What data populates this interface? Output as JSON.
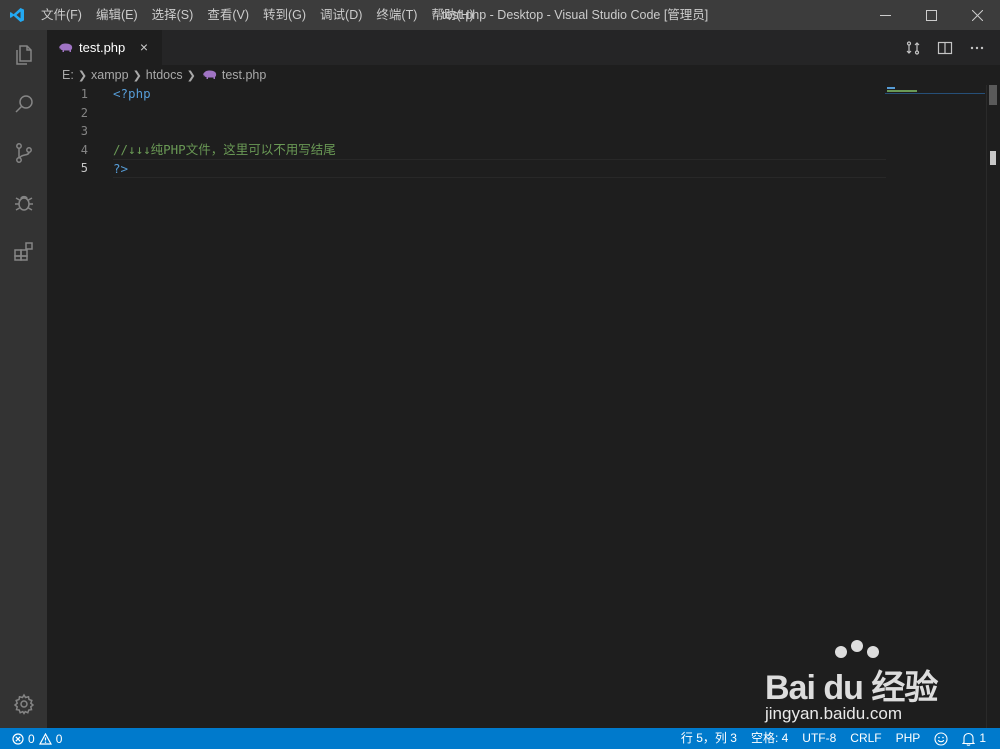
{
  "window": {
    "title": "test.php - Desktop - Visual Studio Code [管理员]",
    "menu": [
      "文件(F)",
      "编辑(E)",
      "选择(S)",
      "查看(V)",
      "转到(G)",
      "调试(D)",
      "终端(T)",
      "帮助(H)"
    ]
  },
  "activity_bar": {
    "items": [
      "files-icon",
      "search-icon",
      "source-control-icon",
      "debug-icon",
      "extensions-icon"
    ],
    "bottom": "gear-icon"
  },
  "tabs": [
    {
      "label": "test.php",
      "icon": "php-elephant-icon",
      "active": true,
      "close": "×"
    }
  ],
  "breadcrumb": [
    "E:",
    "xampp",
    "htdocs",
    "test.php"
  ],
  "editor": {
    "lines": [
      {
        "num": "1",
        "text": "<?php"
      },
      {
        "num": "2",
        "text": ""
      },
      {
        "num": "3",
        "text": ""
      },
      {
        "num": "4",
        "text": "//↓↓↓纯PHP文件，这里可以不用写结尾"
      },
      {
        "num": "5",
        "text": "?>"
      }
    ],
    "current_line": 5
  },
  "statusbar": {
    "errors": "0",
    "warnings": "0",
    "position": "行 5，列 3",
    "indent": "空格: 4",
    "encoding": "UTF-8",
    "eol": "CRLF",
    "language": "PHP",
    "notifications": "1"
  },
  "watermark": {
    "logo": "Bai du 经验",
    "url": "jingyan.baidu.com"
  },
  "colors": {
    "accent": "#007acc",
    "php_tag": "#569cd6",
    "comment": "#6a9955"
  }
}
